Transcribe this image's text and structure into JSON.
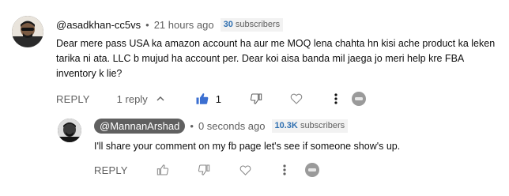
{
  "comments": [
    {
      "author": "@asadkhan-cc5vs",
      "dot": "•",
      "time": "21 hours ago",
      "subs_count": "30",
      "subs_label": "subscribers",
      "text": "Dear mere pass USA ka amazon account ha aur me MOQ lena chahta hn kisi ache product ka leken tarika ni ata. LLC b mujud ha account per. Dear koi aisa banda mil jaega jo meri help kre FBA inventory k lie?",
      "reply_label": "REPLY",
      "replies_label": "1 reply",
      "like_count": "1"
    },
    {
      "author": "@MannanArshad",
      "dot": "•",
      "time": "0 seconds ago",
      "subs_count": "10.3K",
      "subs_label": "subscribers",
      "text": "I'll share your comment on my fb page let's see if someone show's up.",
      "reply_label": "REPLY"
    }
  ],
  "icons": {
    "avatar_1": "user-avatar",
    "avatar_2": "user-avatar",
    "chevron": "chevron-up-icon",
    "like": "thumbs-up-icon",
    "dislike": "thumbs-down-icon",
    "heart": "heart-icon",
    "more": "more-vert-icon",
    "creator": "creator-avatar-icon"
  },
  "colors": {
    "like_active": "#3b6fd1",
    "meta_gray": "#606060",
    "chip_bg": "#606060",
    "subs_number": "#2f6fb0"
  }
}
